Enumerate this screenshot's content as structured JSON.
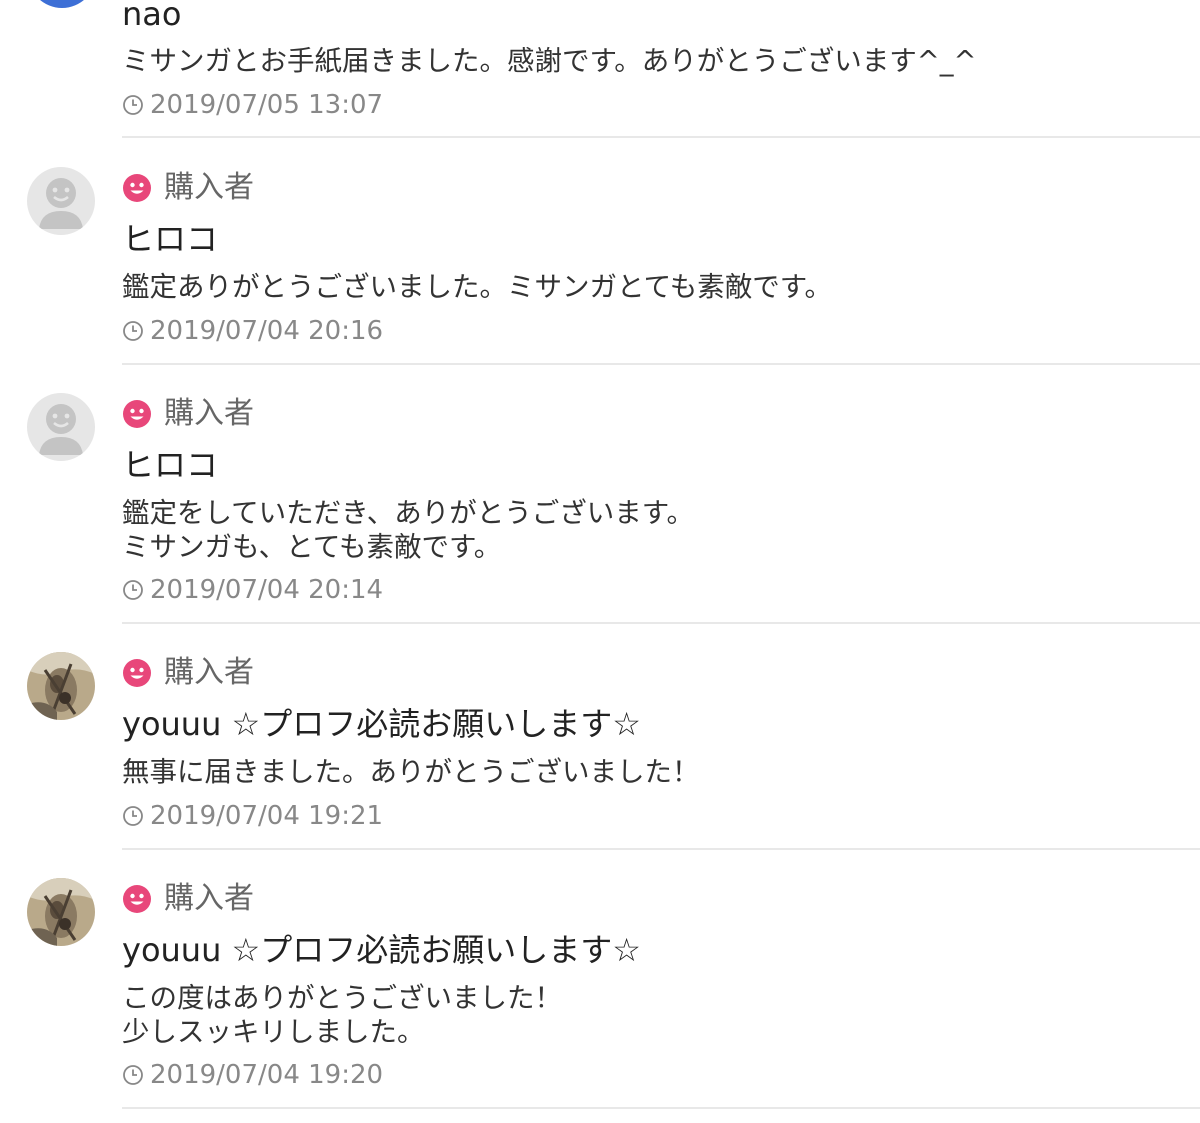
{
  "colors": {
    "badge_pink": "#e8477a",
    "top_avatar_blue": "#3d6fd6"
  },
  "reviews": [
    {
      "username": "nao",
      "message": "ミサンガとお手紙届きました。感謝です。ありがとうございます^_^",
      "date": "2019/07/05 13:07",
      "avatar_icon": "user-avatar-icon"
    },
    {
      "badge": "購入者",
      "username": "ヒロコ",
      "message": "鑑定ありがとうございました。ミサンガとても素敵です。",
      "date": "2019/07/04 20:16",
      "avatar_icon": "default-user-avatar-icon"
    },
    {
      "badge": "購入者",
      "username": "ヒロコ",
      "message": "鑑定をしていただき、ありがとうございます。\nミサンガも、とても素敵です。",
      "date": "2019/07/04 20:14",
      "avatar_icon": "default-user-avatar-icon"
    },
    {
      "badge": "購入者",
      "username": "youuu ☆プロフ必読お願いします☆",
      "message": "無事に届きました。ありがとうございました！",
      "date": "2019/07/04 19:21",
      "avatar_icon": "photo-avatar-icon"
    },
    {
      "badge": "購入者",
      "username": "youuu ☆プロフ必読お願いします☆",
      "message": "この度はありがとうございました！\n少しスッキリしました。",
      "date": "2019/07/04 19:20",
      "avatar_icon": "photo-avatar-icon"
    }
  ]
}
